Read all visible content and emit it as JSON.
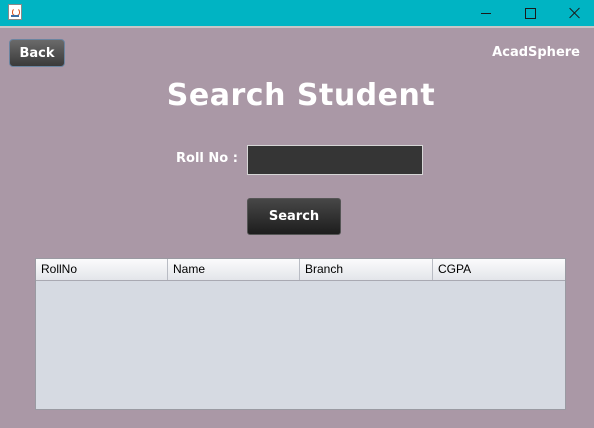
{
  "window": {
    "title": "",
    "controls": [
      "minimize",
      "maximize",
      "close"
    ]
  },
  "header": {
    "back_label": "Back",
    "brand": "AcadSphere"
  },
  "main": {
    "title": "Search Student",
    "roll_label": "Roll No :",
    "roll_value": "",
    "search_label": "Search"
  },
  "table": {
    "columns": [
      "RollNo",
      "Name",
      "Branch",
      "CGPA"
    ],
    "rows": []
  },
  "colors": {
    "background": "#aa98a6",
    "titlebar": "#00b4c3",
    "button_dark": "#2a2a2a",
    "text_light": "#ffffff"
  },
  "icons": {
    "app": "java-app-icon",
    "minimize": "minimize-icon",
    "maximize": "maximize-icon",
    "close": "close-icon"
  }
}
